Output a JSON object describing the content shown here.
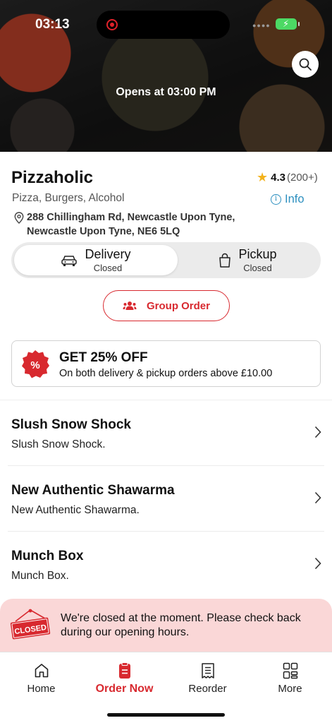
{
  "status_bar": {
    "time": "03:13"
  },
  "hero": {
    "opens_text": "Opens at 03:00 PM"
  },
  "restaurant": {
    "name": "Pizzaholic",
    "rating": "4.3",
    "rating_count": "(200+)",
    "cuisine": "Pizza, Burgers, Alcohol",
    "info_label": "Info",
    "address_line1": "288 Chillingham Rd, Newcastle Upon Tyne,",
    "address_line2": "Newcastle Upon Tyne, NE6 5LQ"
  },
  "order_type": {
    "delivery": {
      "label": "Delivery",
      "status": "Closed",
      "selected": true
    },
    "pickup": {
      "label": "Pickup",
      "status": "Closed",
      "selected": false
    }
  },
  "group_order": {
    "label": "Group Order"
  },
  "offer": {
    "title": "GET 25% OFF",
    "description": "On both delivery & pickup orders above £10.00"
  },
  "menu": [
    {
      "title": "Slush Snow Shock",
      "description": "Slush Snow Shock."
    },
    {
      "title": "New Authentic Shawarma",
      "description": "New Authentic Shawarma."
    },
    {
      "title": "Munch Box",
      "description": "Munch Box."
    }
  ],
  "closed_banner": {
    "sign_text": "CLOSED",
    "message": "We're closed at the moment. Please check back during our opening hours."
  },
  "tabs": [
    {
      "label": "Home",
      "icon": "home-icon",
      "active": false
    },
    {
      "label": "Order Now",
      "icon": "order-icon",
      "active": true
    },
    {
      "label": "Reorder",
      "icon": "receipt-icon",
      "active": false
    },
    {
      "label": "More",
      "icon": "grid-icon",
      "active": false
    }
  ],
  "colors": {
    "accent": "#d8292f",
    "link": "#2c8fbf",
    "star": "#f3b21b",
    "banner_bg": "#fad7d7"
  }
}
